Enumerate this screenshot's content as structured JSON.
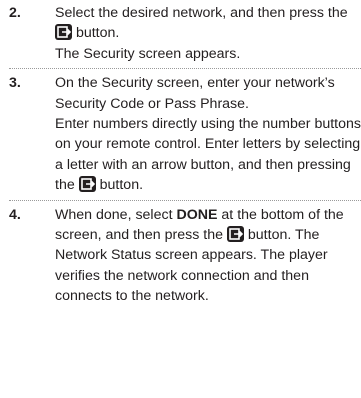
{
  "steps": [
    {
      "number": "2.",
      "line1_before_icon": "Select the desired network, and then press the",
      "line1_after_icon": "button.",
      "line2": "The Security screen appears.",
      "icon": "enter-button-icon"
    },
    {
      "number": "3.",
      "para1": "On the Security screen, enter your network’s Security Code or Pass Phrase.",
      "para2_before_icon": "Enter numbers directly using the number buttons on your remote control. Enter letters by selecting a letter with an arrow button, and then pressing the",
      "para2_after_icon": "button.",
      "icon": "enter-button-icon"
    },
    {
      "number": "4.",
      "text_before_bold": "When done, select",
      "bold_word": "DONE",
      "text_after_bold": "at the bottom of the screen, and then press the",
      "text_after_icon": "button. The Network Status screen appears. The player verifies the network connection and then connects to the network.",
      "icon": "enter-button-icon"
    }
  ]
}
